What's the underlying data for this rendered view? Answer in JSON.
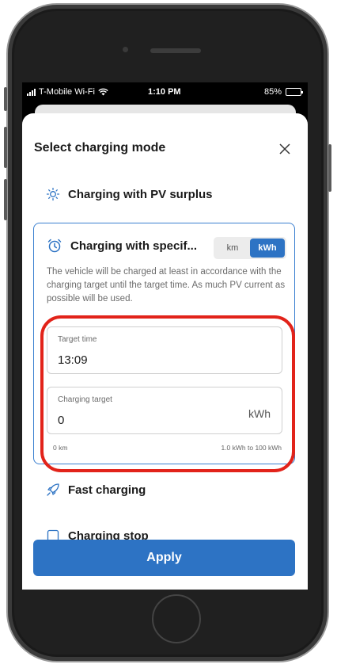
{
  "status_bar": {
    "carrier": "T-Mobile Wi-Fi",
    "time": "1:10 PM",
    "battery": "85%"
  },
  "sheet": {
    "title": "Select charging mode",
    "modes": {
      "pv_surplus": "Charging with PV surplus",
      "specific": "Charging with specif...",
      "fast": "Fast charging",
      "stop": "Charging stop"
    },
    "unit_toggle": {
      "options": [
        "km",
        "kWh"
      ],
      "selected": "kWh"
    },
    "description": "The vehicle will be charged at least in accordance with the charging target until the target time. As much PV current as possible will be used.",
    "target_time": {
      "label": "Target time",
      "value": "13:09"
    },
    "charging_target": {
      "label": "Charging target",
      "value": "0",
      "unit": "kWh"
    },
    "hint_left": "0 km",
    "hint_right": "1.0 kWh to 100 kWh",
    "apply_label": "Apply"
  },
  "colors": {
    "accent": "#2d73c4",
    "highlight": "#e2231a"
  }
}
